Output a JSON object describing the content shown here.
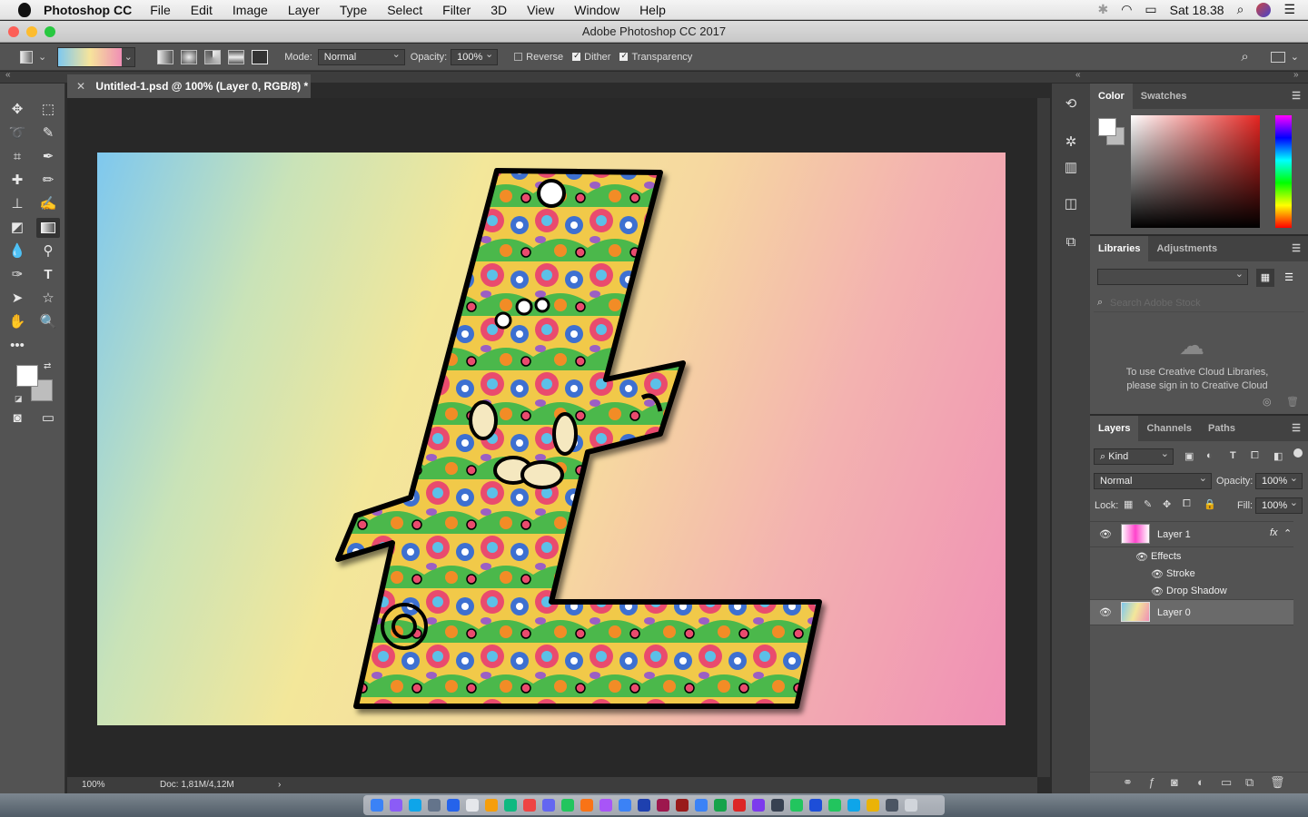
{
  "menubar": {
    "app_name": "Photoshop CC",
    "items": [
      "File",
      "Edit",
      "Image",
      "Layer",
      "Type",
      "Select",
      "Filter",
      "3D",
      "View",
      "Window",
      "Help"
    ],
    "clock": "Sat 18.38"
  },
  "window": {
    "title": "Adobe Photoshop CC 2017"
  },
  "options": {
    "mode_label": "Mode:",
    "mode_value": "Normal",
    "opacity_label": "Opacity:",
    "opacity_value": "100%",
    "reverse": "Reverse",
    "dither": "Dither",
    "transparency": "Transparency",
    "reverse_checked": false,
    "dither_checked": true,
    "transparency_checked": true
  },
  "document": {
    "tab_title": "Untitled-1.psd @ 100% (Layer 0, RGB/8) *",
    "zoom": "100%",
    "doc_size": "Doc: 1,81M/4,12M"
  },
  "color_panel": {
    "tabs": [
      "Color",
      "Swatches"
    ]
  },
  "libraries_panel": {
    "tabs": [
      "Libraries",
      "Adjustments"
    ],
    "search_placeholder": "Search Adobe Stock",
    "message_line1": "To use Creative Cloud Libraries,",
    "message_line2": "please sign in to Creative Cloud"
  },
  "layers_panel": {
    "tabs": [
      "Layers",
      "Channels",
      "Paths"
    ],
    "filter_kind": "Kind",
    "blend_mode": "Normal",
    "opacity_label": "Opacity:",
    "opacity_value": "100%",
    "lock_label": "Lock:",
    "fill_label": "Fill:",
    "fill_value": "100%",
    "layers": [
      {
        "name": "Layer 1",
        "fx": "fx"
      },
      {
        "name": "Effects"
      },
      {
        "name": "Stroke"
      },
      {
        "name": "Drop Shadow"
      },
      {
        "name": "Layer 0"
      }
    ]
  },
  "colors": {
    "ui_bg": "#535353",
    "canvas_bg": "#282828",
    "accent_active": "#333333"
  }
}
